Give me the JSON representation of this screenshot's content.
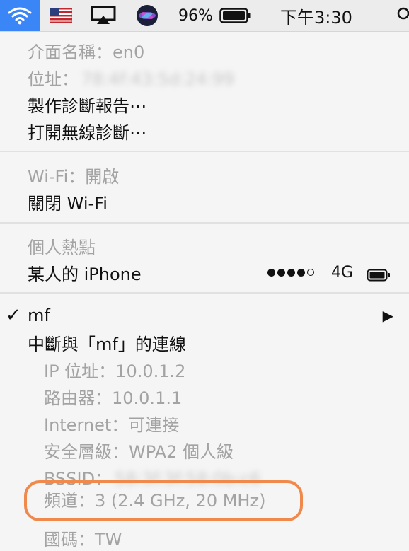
{
  "menubar": {
    "battery_percent": "96%",
    "clock": "下午3:30"
  },
  "interface": {
    "name_row": "介面名稱：en0",
    "address_label": "位址：",
    "address_value": "78:4f:43:5d:24:99",
    "diagnostics_report": "製作診斷報告⋯",
    "open_wireless_diagnostics": "打開無線診斷⋯"
  },
  "wifi": {
    "status": "Wi-Fi：開啟",
    "toggle": "關閉 Wi-Fi"
  },
  "hotspot": {
    "header": "個人熱點",
    "device": "某人的 iPhone",
    "signal_bars": 4,
    "signal_total": 5,
    "network_type": "4G"
  },
  "network": {
    "name": "mf",
    "disconnect": "中斷與「mf」的連線",
    "details": [
      {
        "text": "IP 位址：10.0.1.2"
      },
      {
        "text": "路由器：10.0.1.1"
      },
      {
        "text": "Internet：可連接"
      },
      {
        "text": "安全層級：WPA2 個人級"
      }
    ],
    "bssid_label": "BSSID：",
    "bssid_value": "58:3f:3f:58:0b:c6",
    "channel": "頻道：3 (2.4 GHz, 20 MHz)",
    "country": "國碼：TW"
  },
  "colors": {
    "accent": "#3b86f7",
    "highlight": "#ef8a4c",
    "disabled_text": "#a3a3a3"
  }
}
